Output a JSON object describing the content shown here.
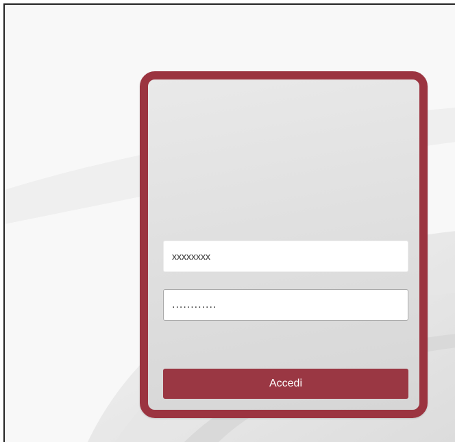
{
  "theme": {
    "accent": "#9b3440",
    "button": "#9a3743"
  },
  "login": {
    "username_value": "xxxxxxxx",
    "password_value": "............",
    "submit_label": "Accedi"
  }
}
